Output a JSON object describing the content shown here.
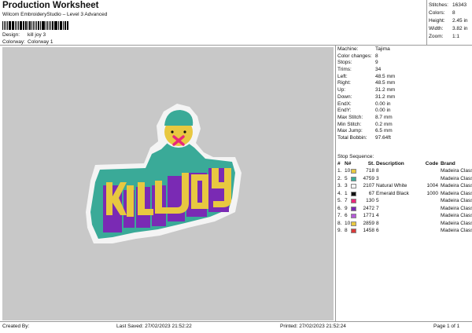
{
  "header": {
    "title": "Production Worksheet",
    "subtitle": "Wilcom EmbroideryStudio – Level 3 Advanced"
  },
  "meta": [
    {
      "label": "Design:",
      "value": "kill joy 3"
    },
    {
      "label": "Colorway:",
      "value": "Colorway 1"
    }
  ],
  "top_stats": [
    {
      "label": "Stitches:",
      "value": "16343"
    },
    {
      "label": "Colors:",
      "value": "8"
    },
    {
      "label": "Height:",
      "value": "2.45 in"
    },
    {
      "label": "Width:",
      "value": "3.82 in"
    },
    {
      "label": "Zoom:",
      "value": "1:1"
    }
  ],
  "machine_props": [
    {
      "label": "Machine:",
      "value": "Tajima"
    },
    {
      "label": "Color changes:",
      "value": "8"
    },
    {
      "label": "Stops:",
      "value": "9"
    },
    {
      "label": "Trims:",
      "value": "34"
    },
    {
      "label": "Left:",
      "value": "48.5 mm"
    },
    {
      "label": "Right:",
      "value": "48.5 mm"
    },
    {
      "label": "Up:",
      "value": "31.2 mm"
    },
    {
      "label": "Down:",
      "value": "31.2 mm"
    },
    {
      "label": "EndX:",
      "value": "0.00 in"
    },
    {
      "label": "EndY:",
      "value": "0.00 in"
    },
    {
      "label": "Max Stitch:",
      "value": "8.7 mm"
    },
    {
      "label": "Min Stitch:",
      "value": "0.2 mm"
    },
    {
      "label": "Max Jump:",
      "value": "6.5 mm"
    },
    {
      "label": "Total Bobbin:",
      "value": "97.64ft"
    }
  ],
  "stop_sequence": {
    "label": "Stop Sequence:",
    "headers": [
      "#",
      "N#",
      "St.",
      "Description",
      "Code",
      "Brand"
    ],
    "rows": [
      {
        "num": "1.",
        "n": "10",
        "color": "#e8c840",
        "st": "718",
        "desc": "8",
        "code": "",
        "brand": "Madeira Classic 40"
      },
      {
        "num": "2.",
        "n": "5",
        "color": "#3aaa98",
        "st": "4759",
        "desc": "3",
        "code": "",
        "brand": "Madeira Classic 40"
      },
      {
        "num": "3.",
        "n": "3",
        "color": "#f4f4f4",
        "st": "2107",
        "desc": "Natural White",
        "code": "1004",
        "brand": "Madeira Classic 40"
      },
      {
        "num": "4.",
        "n": "1",
        "color": "#111111",
        "st": "67",
        "desc": "Emerald Black",
        "code": "1000",
        "brand": "Madeira Classic 40"
      },
      {
        "num": "5.",
        "n": "7",
        "color": "#e8287a",
        "st": "130",
        "desc": "5",
        "code": "",
        "brand": "Madeira Classic 40"
      },
      {
        "num": "6.",
        "n": "9",
        "color": "#7a2ab4",
        "st": "2472",
        "desc": "7",
        "code": "",
        "brand": "Madeira Classic 40"
      },
      {
        "num": "7.",
        "n": "6",
        "color": "#b45ad8",
        "st": "1771",
        "desc": "4",
        "code": "",
        "brand": "Madeira Classic 40"
      },
      {
        "num": "8.",
        "n": "10",
        "color": "#e8c840",
        "st": "2859",
        "desc": "8",
        "code": "",
        "brand": "Madeira Classic 40"
      },
      {
        "num": "9.",
        "n": "8",
        "color": "#d83a3a",
        "st": "1458",
        "desc": "6",
        "code": "",
        "brand": "Madeira Classic 40"
      }
    ]
  },
  "design": {
    "letters": [
      "K",
      "I",
      "L",
      "L",
      "J",
      "O",
      "Y"
    ],
    "colors": {
      "canvas": "#c8c8c8",
      "teal": "#3aaa98",
      "yellow": "#e8c840",
      "purple": "#7a2ab4",
      "white": "#f4f4f4",
      "pink": "#e8287a"
    }
  },
  "footer": {
    "created": "Created By:",
    "saved": "Last Saved: 27/02/2023 21:52:22",
    "printed": "Printed: 27/02/2023 21:52:24",
    "page": "Page 1 of 1"
  }
}
